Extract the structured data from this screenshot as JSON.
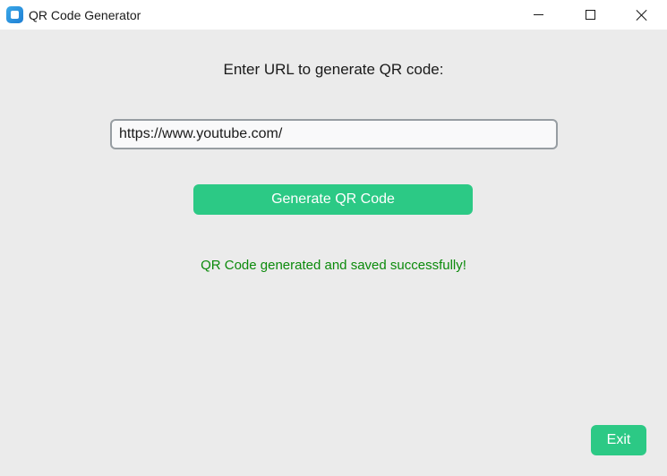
{
  "window": {
    "title": "QR Code Generator",
    "icon": "app-window-icon",
    "controls": {
      "minimize_icon": "minimize-icon",
      "maximize_icon": "maximize-icon",
      "close_icon": "close-icon"
    }
  },
  "main": {
    "prompt_label": "Enter URL to generate QR code:",
    "url_input": {
      "value": "https://www.youtube.com/",
      "placeholder": ""
    },
    "generate_button_label": "Generate QR Code",
    "status_message": "QR Code generated and saved successfully!",
    "exit_button_label": "Exit"
  },
  "colors": {
    "accent_button": "#2cc985",
    "success_text": "#0b8a0b",
    "background": "#ebebeb"
  }
}
